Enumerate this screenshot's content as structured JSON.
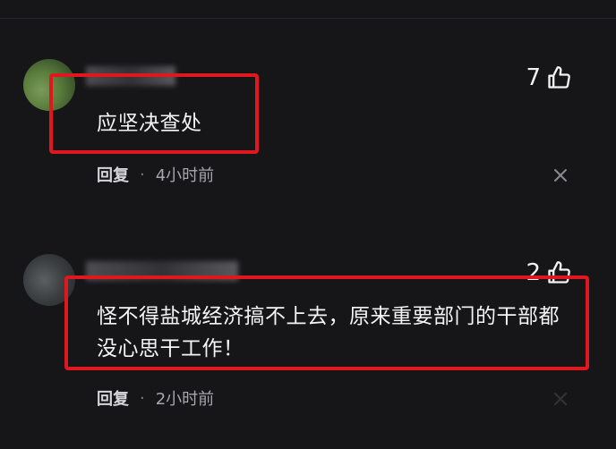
{
  "comments": [
    {
      "likes": "7",
      "text": "应坚决查处",
      "reply_label": "回复",
      "separator": "·",
      "time": "4小时前"
    },
    {
      "likes": "2",
      "text": "怪不得盐城经济搞不上去，原来重要部门的干部都没心思干工作！",
      "reply_label": "回复",
      "separator": "·",
      "time": "2小时前"
    }
  ],
  "colors": {
    "background": "#161618",
    "highlight_border": "#e0171d",
    "text": "#f4f4f4",
    "meta": "#b9b9bd"
  },
  "icons": [
    "thumbs-up-icon",
    "close-icon"
  ]
}
